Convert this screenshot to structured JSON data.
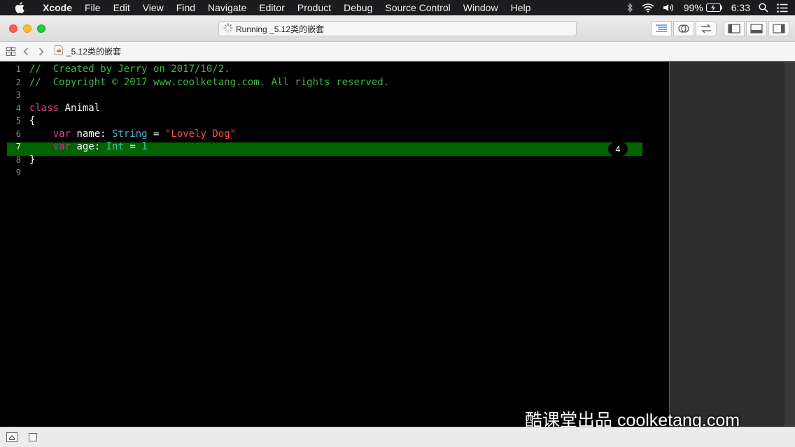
{
  "menubar": {
    "app": "Xcode",
    "items": [
      "File",
      "Edit",
      "View",
      "Find",
      "Navigate",
      "Editor",
      "Product",
      "Debug",
      "Source Control",
      "Window",
      "Help"
    ],
    "battery": "99%",
    "time": "6:33"
  },
  "toolbar": {
    "activity": "Running _5.12类的嵌套"
  },
  "jumpbar": {
    "file": "_5.12类的嵌套"
  },
  "editor": {
    "line_numbers": [
      "1",
      "2",
      "3",
      "4",
      "5",
      "6",
      "7",
      "8",
      "9"
    ],
    "current_line": "7",
    "line1": "//  Created by Jerry on 2017/10/2.",
    "line2": "//  Copyright © 2017 www.coolketang.com. All rights reserved.",
    "line4_kw": "class",
    "line4_name": " Animal",
    "line5": "{",
    "line6_kw": "var",
    "line6_name": " name: ",
    "line6_type": "String",
    "line6_eq": " = ",
    "line6_str": "\"Lovely Dog\"",
    "line7_kw": "var",
    "line7_name": " age: ",
    "line7_type": "Int",
    "line7_eq": " = ",
    "line7_num": "1",
    "line8": "}",
    "result_badge": "4"
  },
  "watermark": "酷课堂出品 coolketang.com",
  "colors": {
    "highlight": "#006400",
    "comment": "#41b645",
    "keyword": "#e5408f",
    "type": "#4eb0cc",
    "string": "#ff4a4a"
  }
}
